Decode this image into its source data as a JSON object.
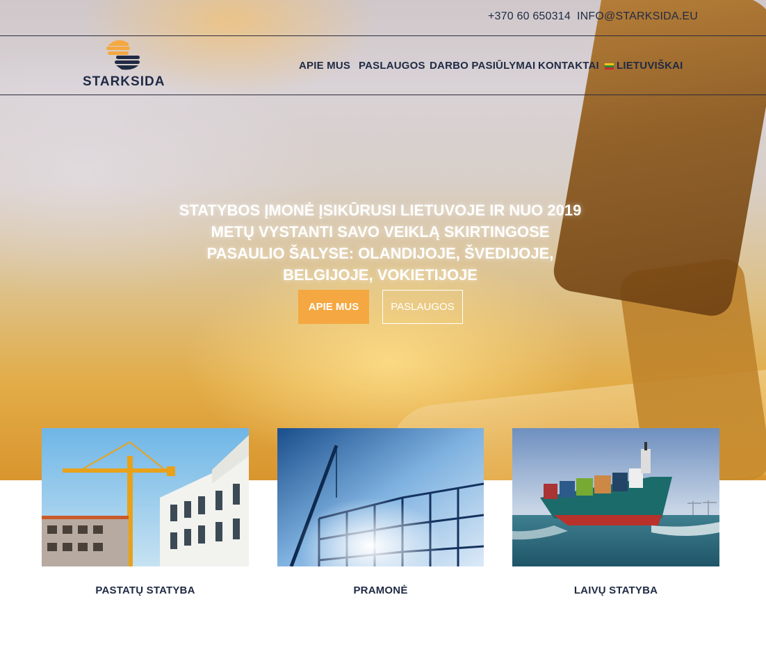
{
  "topbar": {
    "phone": "+370 60 650314",
    "email": "INFO@STARKSIDA.EU"
  },
  "brand": {
    "name": "STARKSIDA",
    "logo_icon": "stacked-sun-logo-icon",
    "primary_color": "#1f2a44",
    "accent_color": "#f5a841"
  },
  "nav": {
    "items": [
      {
        "label": "APIE MUS"
      },
      {
        "label": "PASLAUGOS"
      },
      {
        "label": "DARBO PASIŪLYMAI"
      },
      {
        "label": "KONTAKTAI"
      }
    ],
    "language": {
      "label": "LIETUVIŠKAI",
      "icon": "lithuania-flag-icon"
    }
  },
  "hero": {
    "heading": "STATYBOS ĮMONĖ ĮSIKŪRUSI LIETUVOJE IR NUO 2019 METŲ VYSTANTI SAVO VEIKLĄ SKIRTINGOSE PASAULIO ŠALYSE: OLANDIJOJE, ŠVEDIJOJE, BELGIJOJE, VOKIETIJOJE",
    "primary_button": "APIE MUS",
    "secondary_button": "PASLAUGOS"
  },
  "services": [
    {
      "title": "PASTATŲ STATYBA",
      "image": "building-construction-cranes-image"
    },
    {
      "title": "PRAMONĖ",
      "image": "industrial-steel-frame-image"
    },
    {
      "title": "LAIVŲ STATYBA",
      "image": "cargo-ship-image"
    }
  ]
}
